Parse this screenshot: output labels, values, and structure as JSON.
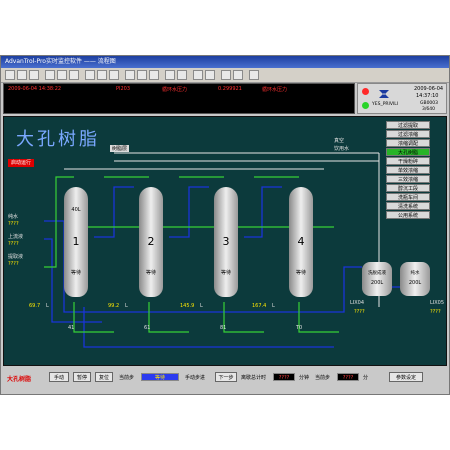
{
  "window": {
    "title": "AdvanTrol-Pro实时监控软件 —— 流程图"
  },
  "toolbar": {
    "icons": [
      "open-icon",
      "save-icon",
      "print-icon",
      "trend-icon",
      "alarm-icon",
      "report-icon",
      "group-icon",
      "overview-icon",
      "tune-icon",
      "flow-icon",
      "data-icon",
      "log-icon",
      "find-icon",
      "zoom-icon",
      "lock-icon",
      "user-icon",
      "close-icon",
      "help-icon",
      "exit-icon"
    ]
  },
  "alarm": {
    "time": "2009-06-04 14:38:22",
    "tag": "PI203",
    "message": "循环水压力",
    "value": "0.299921",
    "message2": "循环水压力"
  },
  "info": {
    "date": "2009-06-04",
    "time": "14:37:10",
    "user": "YES_PRIVILI",
    "code": "GB0003",
    "page": "3/640"
  },
  "diagram": {
    "title": "大孔树脂",
    "condenser_label": "树脂层",
    "vacuum_label": "真空",
    "water_label": "饮用水",
    "start_button": "启动运行",
    "left_labels": [
      "纯水",
      "上流液",
      "提取液"
    ],
    "left_values": [
      "????",
      "????",
      "????"
    ],
    "columns": [
      {
        "number": "1",
        "capacity": "40L",
        "status": "等待",
        "flow": "69.7",
        "unit": "L",
        "level": "41"
      },
      {
        "number": "2",
        "capacity": "",
        "status": "等待",
        "flow": "99.2",
        "unit": "L",
        "level": "61"
      },
      {
        "number": "3",
        "capacity": "",
        "status": "等待",
        "flow": "145.9",
        "unit": "L",
        "level": "81"
      },
      {
        "number": "4",
        "capacity": "",
        "status": "等待",
        "flow": "167.4",
        "unit": "L",
        "level": "T0"
      }
    ],
    "tanks": [
      {
        "label": "洗脱成液",
        "capacity": "200L",
        "id": "LIX04"
      },
      {
        "label": "纯水",
        "capacity": "200L",
        "id": "LIX05"
      }
    ],
    "tank_values": [
      "????",
      "????"
    ]
  },
  "nav": [
    {
      "label": "过滤提取",
      "active": false
    },
    {
      "label": "过滤浓缩",
      "active": false
    },
    {
      "label": "浓缩调配",
      "active": false
    },
    {
      "label": "大孔树脂",
      "active": true
    },
    {
      "label": "干燥粉碎",
      "active": false
    },
    {
      "label": "单效浓缩",
      "active": false
    },
    {
      "label": "三效浓缩",
      "active": false
    },
    {
      "label": "醇沉工段",
      "active": false
    },
    {
      "label": "洗瓶车间",
      "active": false
    },
    {
      "label": "清洗系统",
      "active": false
    },
    {
      "label": "公用系统",
      "active": false
    }
  ],
  "bottombar": {
    "title": "大孔树脂",
    "auto": "手动",
    "pause": "暂停",
    "reset": "复位",
    "current_step_label": "当前步",
    "current_step_value": "等待",
    "manual_step_label": "手动步进",
    "next_step": "下一步",
    "total_timer_label": "离歇总计时",
    "total_timer_value": "????",
    "minutes": "分钟",
    "current_label": "当前步",
    "current_value": "????",
    "minutes2": "分",
    "param_button": "参数设定"
  },
  "colors": {
    "background": "#0c3a3c",
    "pipe_blue": "#1a35d8",
    "pipe_green": "#37d037",
    "pipe_white": "#e6e6e6",
    "vessel": "#c7c7c7",
    "title": "#7aa8ff",
    "alarm_text": "#ff3030",
    "active_nav": "#28b428"
  }
}
